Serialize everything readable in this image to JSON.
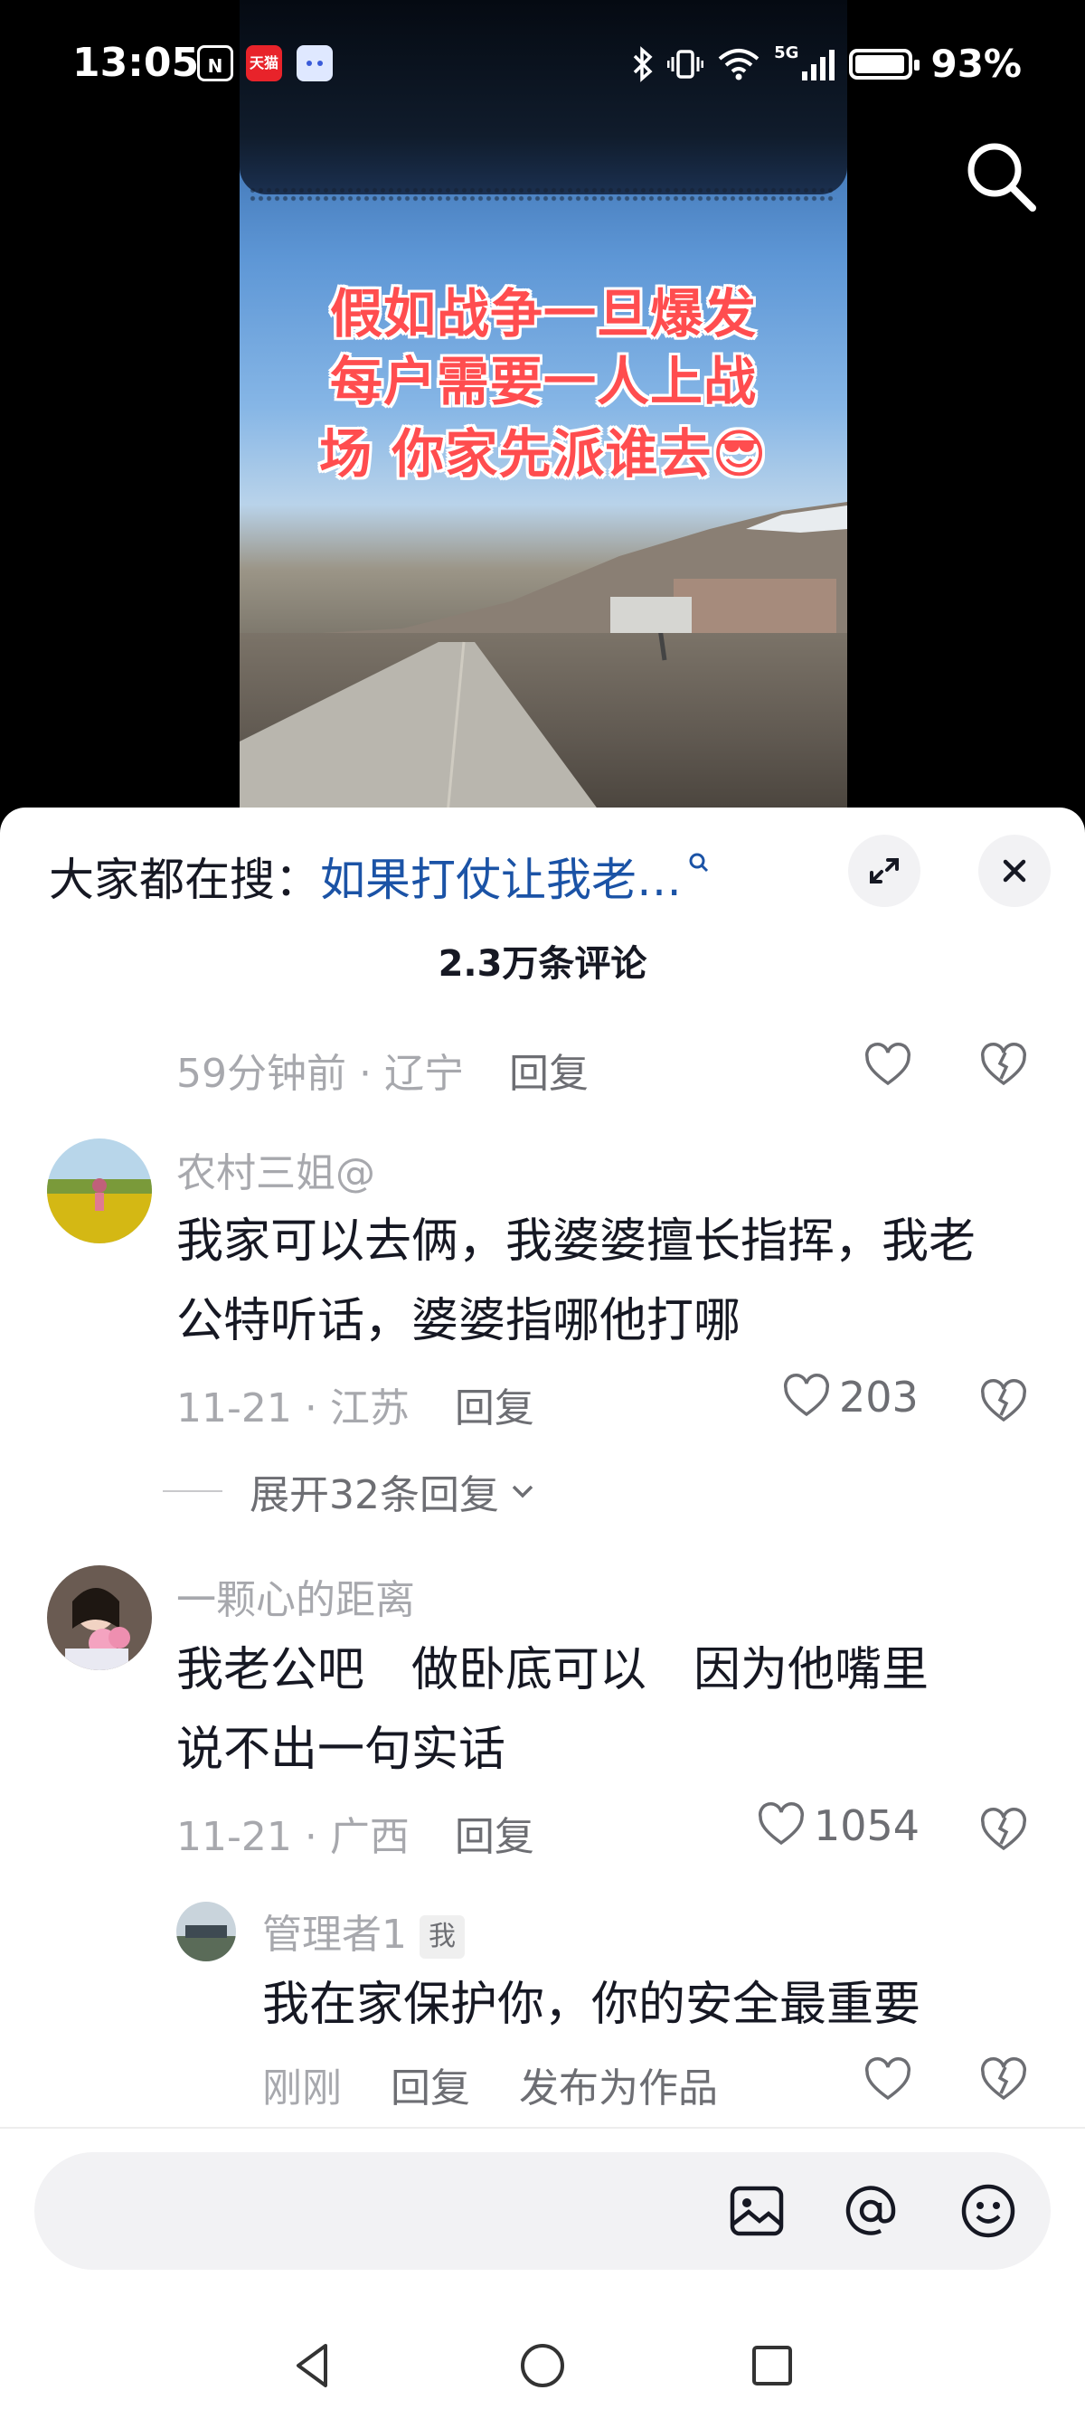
{
  "status_bar": {
    "time": "13:05",
    "nfc_label": "N",
    "tmall_label": "天猫",
    "network": "5G",
    "battery": "93%"
  },
  "video": {
    "overlay_lines": [
      "假如战争一旦爆发",
      "每户需要一人上战",
      "场 你家先派谁去😎"
    ]
  },
  "sheet": {
    "hot_search_prefix": "大家都在搜：",
    "hot_search_query": "如果打仗让我老…",
    "comments_count": "2.3万条评论",
    "reply_label": "回复"
  },
  "comments": [
    {
      "time": "59分钟前",
      "location": "辽宁"
    },
    {
      "user": "农村三姐@",
      "lines": [
        "我家可以去俩，我婆婆擅长指挥，我老",
        "公特听话，婆婆指哪他打哪"
      ],
      "time": "11-21",
      "location": "江苏",
      "likes": "203",
      "expand": "展开32条回复"
    },
    {
      "user": "一颗心的距离",
      "lines": [
        "我老公吧　做卧底可以　因为他嘴里",
        "说不出一句实话"
      ],
      "time": "11-21",
      "location": "广西",
      "likes": "1054"
    },
    {
      "user": "管理者1",
      "badge": "我",
      "lines": [
        "我在家保护你，你的安全最重要"
      ],
      "time": "刚刚",
      "extra": "发布为作品"
    }
  ],
  "icons": {
    "search": "search-icon",
    "expand": "expand-icon",
    "close": "close-icon",
    "like": "heart-icon",
    "dislike": "broken-heart-icon",
    "image": "image-icon",
    "mention": "at-icon",
    "emoji": "emoji-icon"
  },
  "colors": {
    "accent_link": "#1b53a6",
    "like_red": "#ff4d4f"
  }
}
